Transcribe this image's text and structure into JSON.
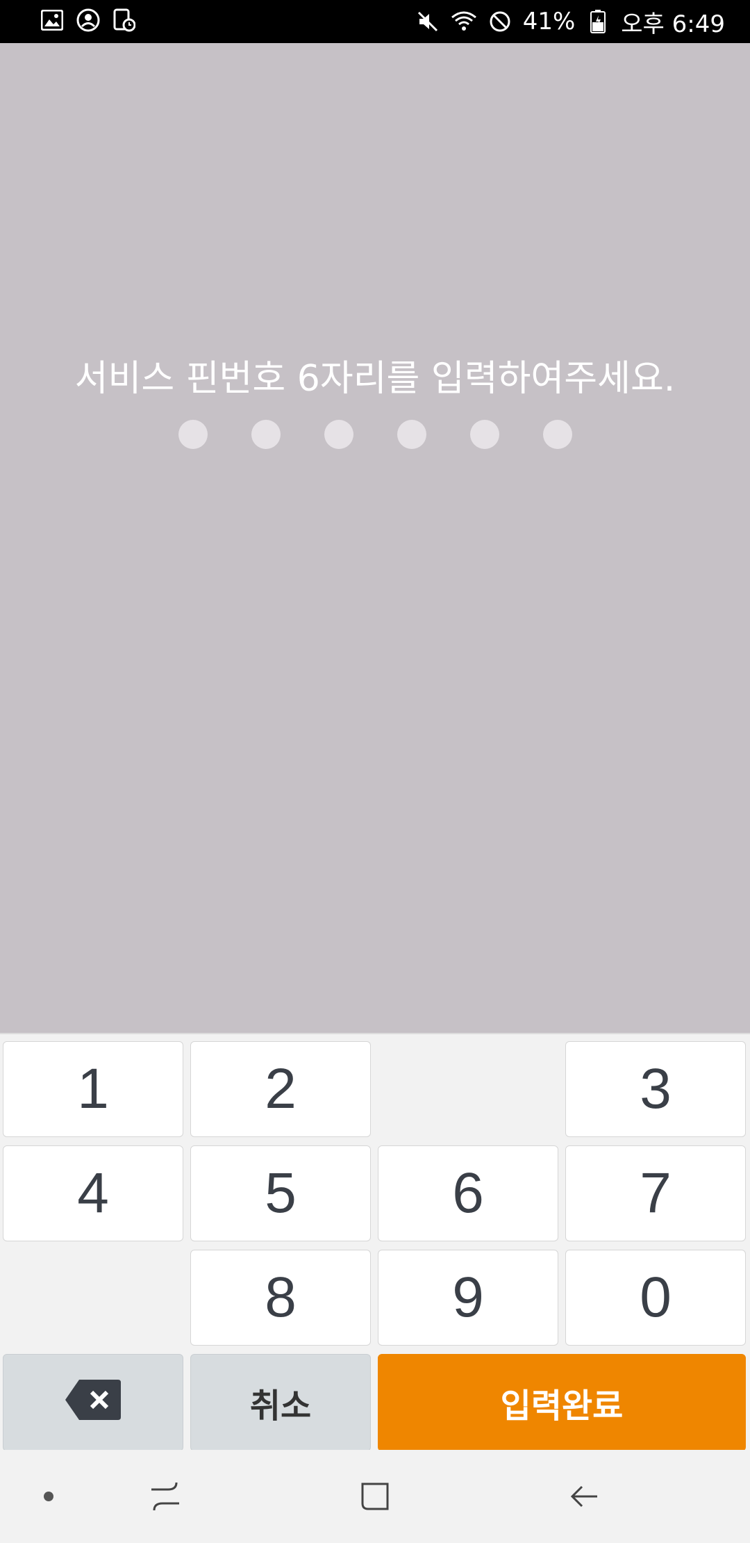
{
  "status_bar": {
    "battery": "41%",
    "time": "오후 6:49",
    "icons": [
      "image-icon",
      "account-icon",
      "device-icon",
      "mute-icon",
      "wifi-icon",
      "blocked-icon",
      "battery-icon"
    ]
  },
  "pin": {
    "prompt": "서비스 핀번호 6자리를 입력하여주세요.",
    "entered_count": 0,
    "length": 6
  },
  "keypad": {
    "keys": {
      "k1": "1",
      "k2": "2",
      "k3": "3",
      "k4": "4",
      "k5": "5",
      "k6": "6",
      "k7": "7",
      "k8": "8",
      "k9": "9",
      "k0": "0"
    },
    "cancel_label": "취소",
    "done_label": "입력완료",
    "done_color": "#ef8600"
  },
  "nav": {
    "icons": [
      "recents-dot-icon",
      "recent-apps-icon",
      "home-icon",
      "back-icon"
    ]
  }
}
